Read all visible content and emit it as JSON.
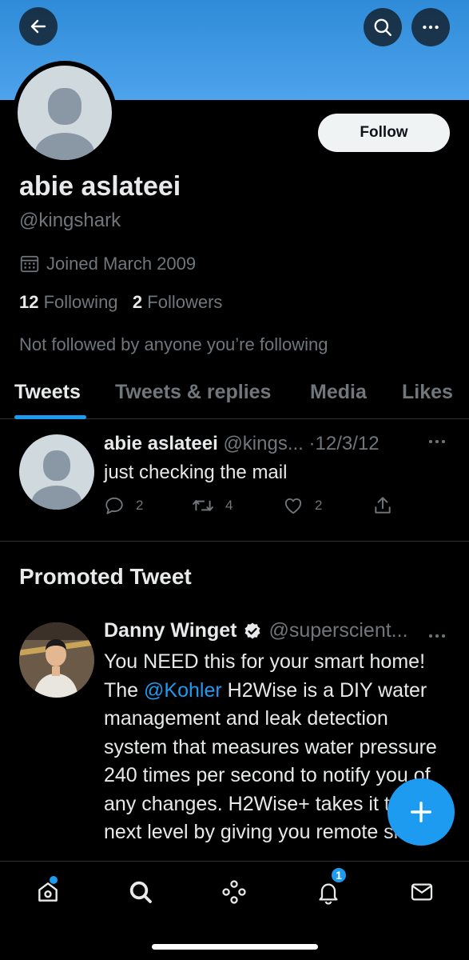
{
  "profile": {
    "name": "abie aslateei",
    "handle": "@kingshark",
    "joined": "Joined March 2009",
    "following_count": "12",
    "following_label": "Following",
    "followers_count": "2",
    "followers_label": "Followers",
    "not_followed": "Not followed by anyone you’re following",
    "follow_label": "Follow"
  },
  "header": {
    "icons": [
      "back-arrow-icon",
      "search-icon",
      "more-icon"
    ],
    "banner_color": "#3b95e2"
  },
  "tabs": [
    {
      "label": "Tweets",
      "active": true
    },
    {
      "label": "Tweets & replies",
      "active": false
    },
    {
      "label": "Media",
      "active": false
    },
    {
      "label": "Likes",
      "active": false
    }
  ],
  "tweet": {
    "name": "abie aslateei",
    "handle": "@kings...",
    "date": "·12/3/12",
    "text": "just checking the mail",
    "replies": "2",
    "retweets": "4",
    "likes": "2"
  },
  "promoted": {
    "section_title": "Promoted Tweet",
    "name": "Danny Winget",
    "handle": "@superscient...",
    "text_before": "You NEED this for your smart home! The ",
    "mention": "@Kohler",
    "text_after": " H2Wise is a DIY water management and leak detection system that measures water pressure 240 times per second to notify you of any changes. H2Wise+ takes it to the next level by giving you remote shut"
  },
  "bottom_nav": {
    "items": [
      "home-icon",
      "search-icon",
      "spaces-icon",
      "notifications-icon",
      "messages-icon"
    ],
    "notification_badge": "1"
  },
  "colors": {
    "accent": "#1d9bf0",
    "background": "#000000",
    "muted": "#71767b"
  }
}
